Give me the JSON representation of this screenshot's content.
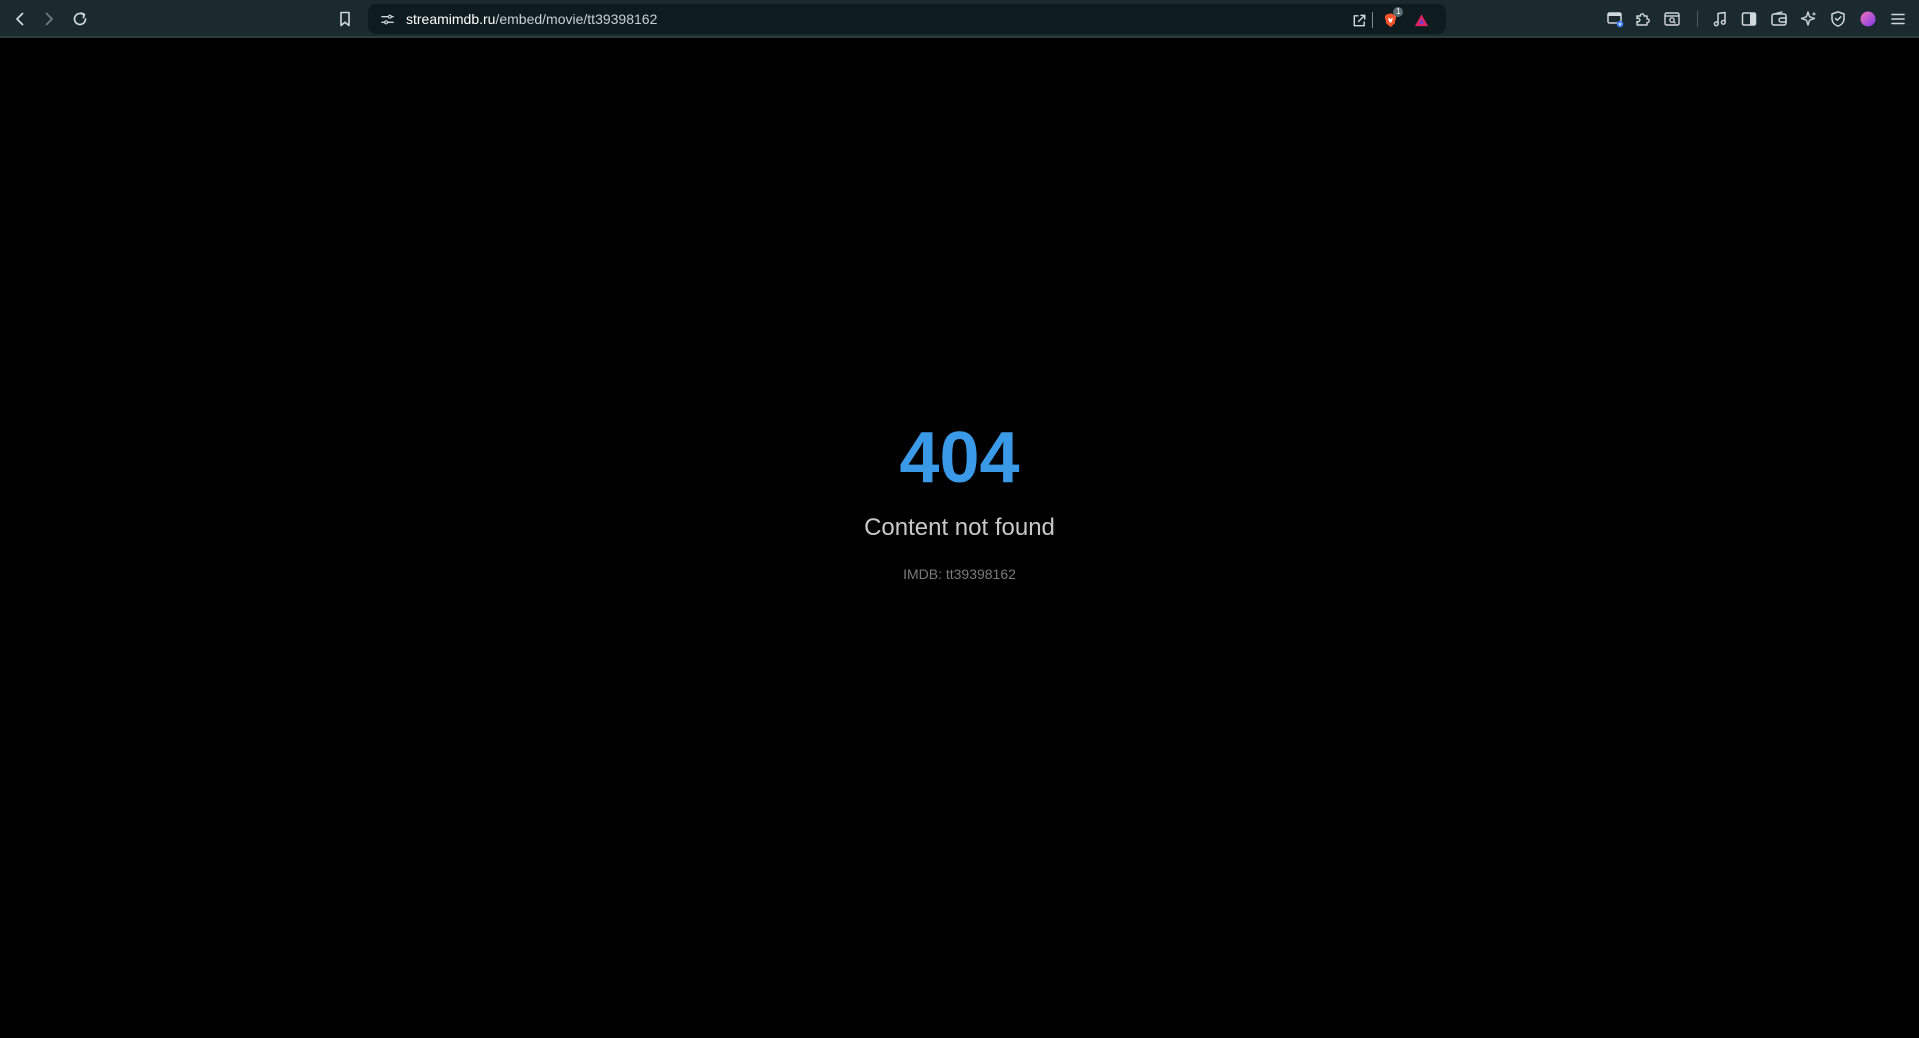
{
  "browser": {
    "url_host": "streamimdb.ru",
    "url_path": "/embed/movie/tt39398162",
    "brave_shield_badge": "1",
    "icons": {
      "back": "back-arrow-icon",
      "forward": "forward-arrow-icon",
      "reload": "reload-icon",
      "bookmark": "bookmark-icon",
      "site_info": "site-settings-icon",
      "share": "share-icon",
      "brave_shields": "brave-shields-icon",
      "brave_rewards": "brave-rewards-icon"
    },
    "colors": {
      "toolbar_bg": "#1b2a2e",
      "addressbar_bg": "#0f1c1f"
    }
  },
  "page": {
    "error_code": "404",
    "message": "Content not found",
    "imdb_label": "IMDB: tt39398162",
    "colors": {
      "error_code": "#3b9ae8",
      "message": "#c8c8c8",
      "imdb_label": "#7a7a7a",
      "background": "#000000"
    }
  }
}
